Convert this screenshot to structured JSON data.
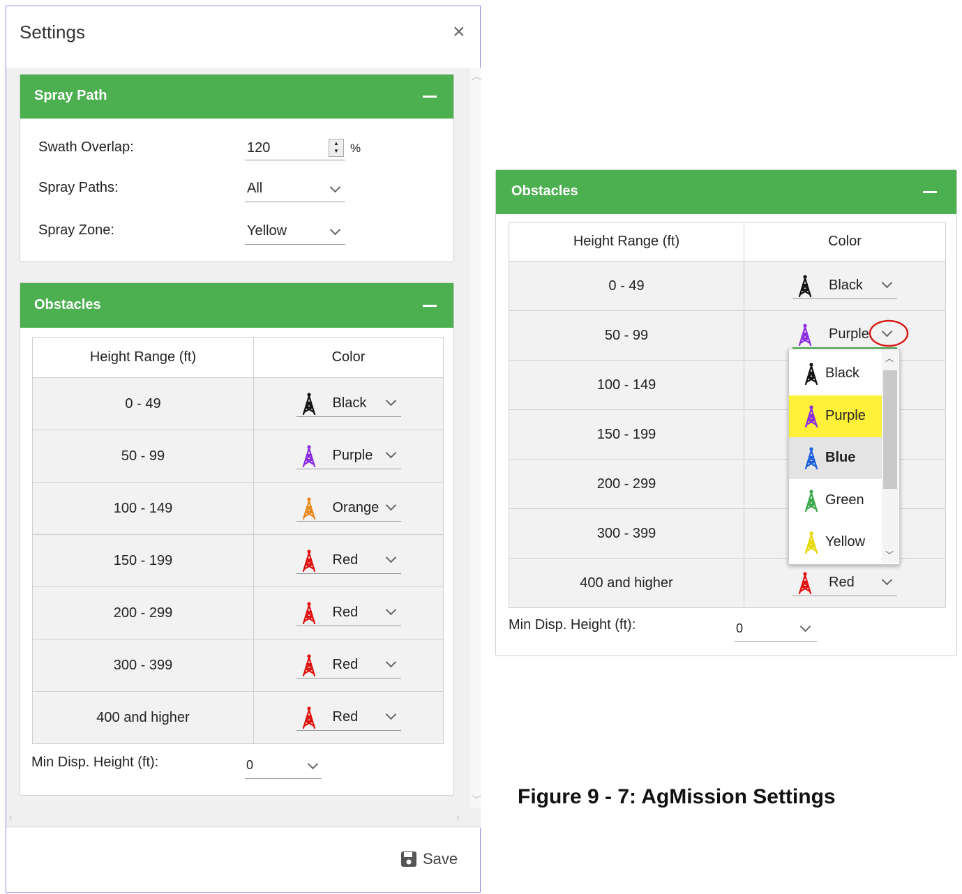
{
  "dialog": {
    "title": "Settings",
    "close_glyph": "×",
    "save_label": "Save",
    "spray_path": {
      "title": "Spray Path",
      "swath_overlap_label": "Swath Overlap:",
      "swath_overlap_value": "120",
      "swath_overlap_unit": "%",
      "spray_paths_label": "Spray Paths:",
      "spray_paths_value": "All",
      "spray_zone_label": "Spray Zone:",
      "spray_zone_value": "Yellow"
    },
    "obstacles": {
      "title": "Obstacles",
      "col_height": "Height Range (ft)",
      "col_color": "Color",
      "rows": [
        {
          "range": "0 - 49",
          "color": "Black",
          "hex": "#111111"
        },
        {
          "range": "50 - 99",
          "color": "Purple",
          "hex": "#8a2be2"
        },
        {
          "range": "100 - 149",
          "color": "Orange",
          "hex": "#e8891a"
        },
        {
          "range": "150 - 199",
          "color": "Red",
          "hex": "#e01010"
        },
        {
          "range": "200 - 299",
          "color": "Red",
          "hex": "#e01010"
        },
        {
          "range": "300 - 399",
          "color": "Red",
          "hex": "#e01010"
        },
        {
          "range": "400 and higher",
          "color": "Red",
          "hex": "#e01010"
        }
      ],
      "min_disp_label": "Min Disp. Height (ft):",
      "min_disp_value": "0"
    }
  },
  "zoom_panel": {
    "title": "Obstacles",
    "col_height": "Height Range (ft)",
    "col_color": "Color",
    "rows": [
      {
        "range": "0 - 49",
        "color": "Black",
        "hex": "#111111"
      },
      {
        "range": "50 - 99",
        "color": "Purple",
        "hex": "#8a2be2"
      },
      {
        "range": "100 - 149"
      },
      {
        "range": "150 - 199"
      },
      {
        "range": "200 - 299"
      },
      {
        "range": "300 - 399"
      },
      {
        "range": "400 and higher",
        "color": "Red",
        "hex": "#e01010"
      }
    ],
    "min_disp_label": "Min Disp. Height (ft):",
    "min_disp_value": "0",
    "dropdown_options": [
      {
        "label": "Black",
        "hex": "#111111",
        "state": "normal"
      },
      {
        "label": "Purple",
        "hex": "#8a2be2",
        "state": "selected"
      },
      {
        "label": "Blue",
        "hex": "#1a5fe0",
        "state": "hover"
      },
      {
        "label": "Green",
        "hex": "#3aa84a",
        "state": "normal"
      },
      {
        "label": "Yellow",
        "hex": "#e6d800",
        "state": "normal"
      }
    ]
  },
  "caption": "Figure 9 - 7:  AgMission Settings",
  "colors": {
    "header_green": "#4caf50",
    "selected_highlight": "#fff03a",
    "hover_gray": "#e4e4e4",
    "annotation_red": "#d81b1b"
  }
}
